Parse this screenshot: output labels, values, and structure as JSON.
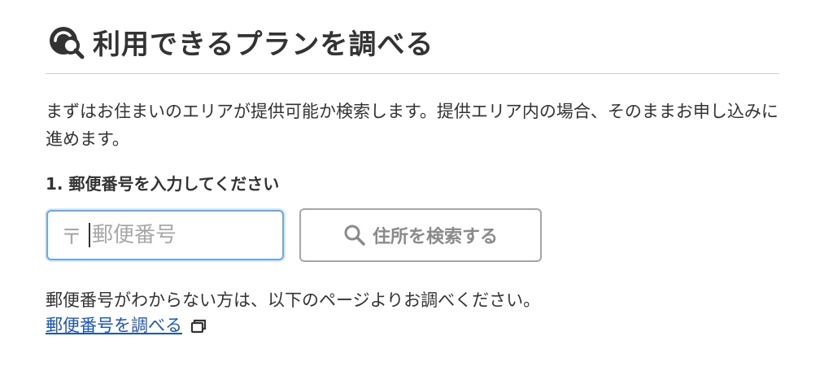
{
  "header": {
    "icon": "search-area-icon",
    "title": "利用できるプランを調べる"
  },
  "description": "まずはお住まいのエリアが提供可能か検索します。提供エリア内の場合、そのままお申し込みに進めます。",
  "step": {
    "label": "1. 郵便番号を入力してください"
  },
  "postal_code": {
    "mark": "〒",
    "placeholder": "郵便番号",
    "value": ""
  },
  "search_button": {
    "icon": "magnifier-icon",
    "label": "住所を検索する"
  },
  "help": {
    "text": "郵便番号がわからない方は、以下のページよりお調べください。",
    "link_label": "郵便番号を調べる",
    "link_icon": "external-window-icon"
  },
  "colors": {
    "input_focus_border": "#6aa7e6",
    "button_border": "#a6a6a6",
    "link": "#1a56c6",
    "text": "#333333"
  }
}
